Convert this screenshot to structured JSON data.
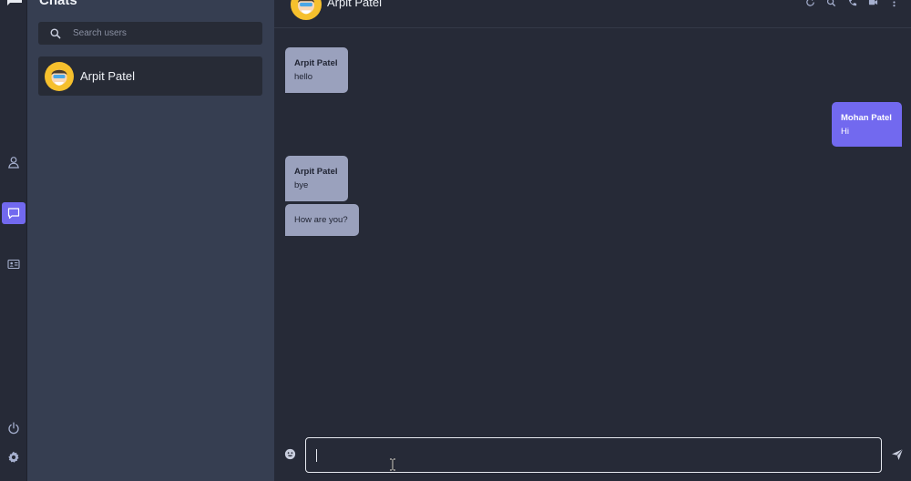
{
  "sidebar": {
    "title": "Chats",
    "search_placeholder": "Search users",
    "contacts": [
      {
        "name": "Arpit Patel"
      }
    ]
  },
  "chat": {
    "peer_name": "Arpit Patel",
    "messages": [
      {
        "direction": "in",
        "sender": "Arpit Patel",
        "text": "hello"
      },
      {
        "direction": "out",
        "sender": "Mohan Patel",
        "text": "Hi"
      },
      {
        "direction": "in",
        "sender": "Arpit Patel",
        "text": "bye"
      },
      {
        "direction": "in",
        "sender": "",
        "text": "How are you?"
      }
    ],
    "composer_value": ""
  },
  "icons": {
    "rail": [
      "logo-icon",
      "user-icon",
      "chat-icon",
      "contacts-icon",
      "power-icon",
      "gear-icon"
    ],
    "header": [
      "refresh-icon",
      "search-icon",
      "phone-icon",
      "video-icon",
      "more-icon"
    ],
    "composer": [
      "emoji-icon",
      "send-icon"
    ]
  },
  "colors": {
    "accent": "#7269ef",
    "incoming_bubble": "#9aa1bd",
    "sidebar_bg": "#363e51",
    "chat_bg": "#262a37"
  }
}
